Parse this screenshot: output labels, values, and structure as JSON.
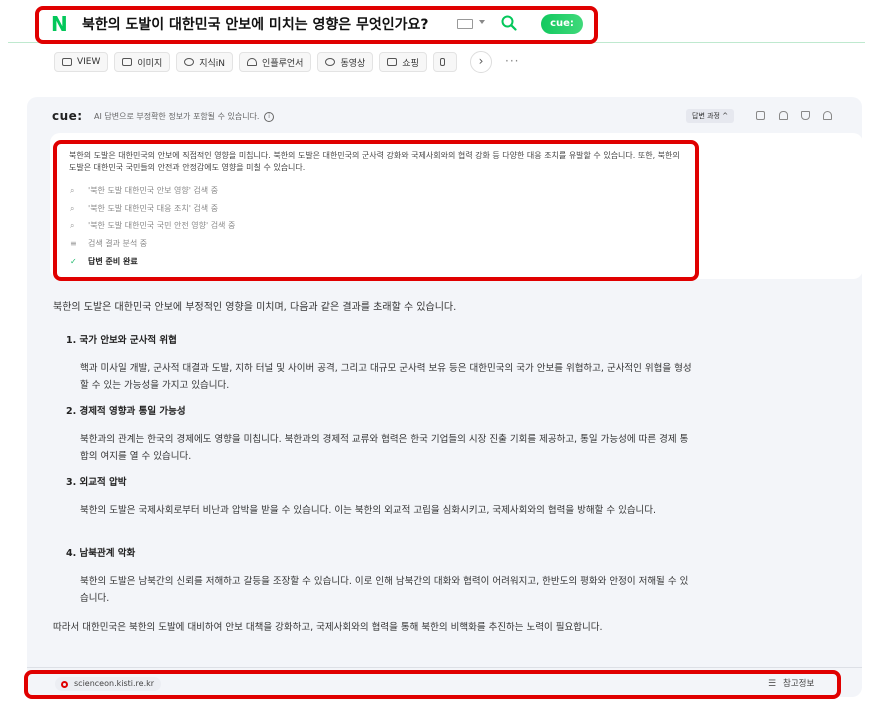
{
  "header": {
    "logo": "N",
    "query": "북한의 도발이 대한민국 안보에 미치는 영향은 무엇인가요?",
    "cue_badge": "cue:"
  },
  "tabs": [
    {
      "label": "VIEW",
      "icon": "view-icon"
    },
    {
      "label": "이미지",
      "icon": "image-icon"
    },
    {
      "label": "지식iN",
      "icon": "kin-icon"
    },
    {
      "label": "인플루언서",
      "icon": "influencer-icon"
    },
    {
      "label": "동영상",
      "icon": "video-icon"
    },
    {
      "label": "쇼핑",
      "icon": "shopping-icon"
    },
    {
      "label": "",
      "icon": "news-icon"
    }
  ],
  "cue": {
    "logo": "cue:",
    "notice": "AI 답변으로 부정확한 정보가 포함될 수 있습니다.",
    "process_button": "답변 과정 ^"
  },
  "process": {
    "summary": "북한의 도발은 대한민국의 안보에 직접적인 영향을 미칩니다. 북한의 도발은 대한민국의 군사력 강화와 국제사회와의 협력 강화 등 다양한 대응 조치를 유발할 수 있습니다. 또한, 북한의 도발은 대한민국 국민들의 안전과 안정감에도 영향을 미칠 수 있습니다.",
    "steps": [
      {
        "icon": "search-icon",
        "label": "'북한 도발 대한민국 안보 영향' 검색 중"
      },
      {
        "icon": "search-icon",
        "label": "'북한 도발 대한민국 대응 조치' 검색 중"
      },
      {
        "icon": "search-icon",
        "label": "'북한 도발 대한민국 국민 안전 영향' 검색 중"
      },
      {
        "icon": "list-icon",
        "label": "검색 결과 분석 중"
      },
      {
        "icon": "check-icon",
        "label": "답변 준비 완료"
      }
    ]
  },
  "answer": {
    "intro": "북한의 도발은 대한민국 안보에 부정적인 영향을 미치며, 다음과 같은 결과를 초래할 수 있습니다.",
    "sections": [
      {
        "heading": "1. 국가 안보와 군사적 위협",
        "body": "핵과 미사일 개발, 군사적 대결과 도발, 지하 터널 및 사이버 공격, 그리고 대규모 군사력 보유 등은 대한민국의 국가 안보를 위협하고, 군사적인 위협을 형성할 수 있는 가능성을 가지고 있습니다."
      },
      {
        "heading": "2. 경제적 영향과 통일 가능성",
        "body": "북한과의 관계는 한국의 경제에도 영향을 미칩니다. 북한과의 경제적 교류와 협력은 한국 기업들의 시장 진출 기회를 제공하고, 통일 가능성에 따른 경제 통합의 여지를 열 수 있습니다."
      },
      {
        "heading": "3. 외교적 압박",
        "body": "북한의 도발은 국제사회로부터 비난과 압박을 받을 수 있습니다. 이는 북한의 외교적 고립을 심화시키고, 국제사회와의 협력을 방해할 수 있습니다."
      },
      {
        "heading": "4. 남북관계 악화",
        "body": "북한의 도발은 남북간의 신뢰를 저해하고 갈등을 조장할 수 있습니다. 이로 인해 남북간의 대화와 협력이 어려워지고, 한반도의 평화와 안정이 저해될 수 있습니다."
      }
    ],
    "conclusion": "따라서 대한민국은 북한의 도발에 대비하여 안보 대책을 강화하고, 국제사회와의 협력을 통해 북한의 비핵화를 추진하는 노력이 필요합니다."
  },
  "footer": {
    "source": "scienceon.kisti.re.kr",
    "reference_label": "참고정보"
  }
}
